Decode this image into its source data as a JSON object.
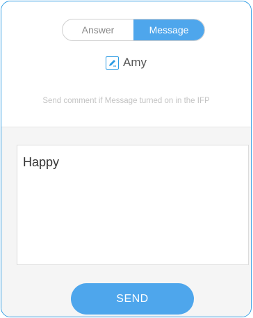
{
  "tabs": [
    {
      "label": "Answer",
      "active": false
    },
    {
      "label": "Message",
      "active": true
    }
  ],
  "user": {
    "name": "Amy",
    "icon": "edit-icon"
  },
  "hint_text": "Send comment if Message turned on in the IFP",
  "message": {
    "value": "Happy"
  },
  "send_label": "SEND",
  "colors": {
    "accent": "#4ea6ec",
    "border": "#2d9be3",
    "bottom_bg": "#f5f5f5"
  }
}
